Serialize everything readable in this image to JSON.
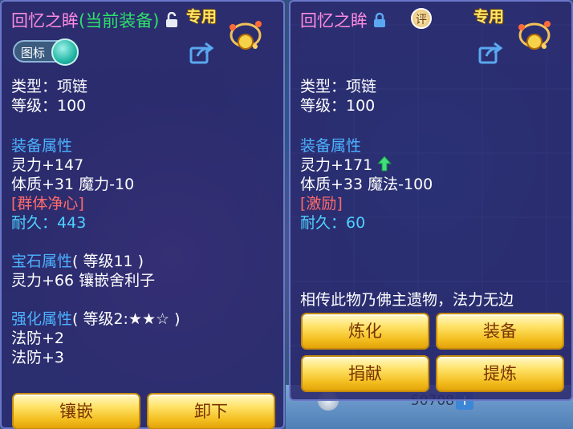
{
  "background": {
    "gold_amount": "50708",
    "gold_plus": "+"
  },
  "left": {
    "name": "回忆之眸",
    "equipped_tag": "(当前装备)",
    "exclusive": "专用",
    "toggle_label": "图标",
    "type_line": "类型：项链",
    "level_line": "等级：100",
    "equip_attr_header": "装备属性",
    "stat1": "灵力+147",
    "stat2": "体质+31 魔力-10",
    "special_skill": "[群体净心]",
    "durability_label": "耐久：",
    "durability_value": "443",
    "gem_header": "宝石属性",
    "gem_level": "( 等级11 )",
    "gem_line": "灵力+66 镶嵌舍利子",
    "enhance_header": "强化属性",
    "enhance_level": "( 等级2:★★☆ )",
    "enhance1": "法防+2",
    "enhance2": "法防+3",
    "btn_inlay": "镶嵌",
    "btn_unequip": "卸下"
  },
  "right": {
    "name": "回忆之眸",
    "ping_label": "评",
    "exclusive": "专用",
    "type_line": "类型：项链",
    "level_line": "等级：100",
    "equip_attr_header": "装备属性",
    "stat1": "灵力+171",
    "stat2": "体质+33 魔法-100",
    "special_skill": "[激励]",
    "durability_label": "耐久：",
    "durability_value": "60",
    "description": "相传此物乃佛主遗物，法力无边",
    "btn_refine": "炼化",
    "btn_equip": "装备",
    "btn_donate": "捐献",
    "btn_extract": "提炼"
  },
  "colors": {
    "title_pink": "#ff8ae0",
    "equipped_green": "#2ee06b",
    "section_blue": "#4db2ff",
    "skill_red": "#ff6a6a",
    "durability_cyan": "#4fd1ff",
    "button_gold": "#f3be1f"
  },
  "icons": [
    "lock-open-icon",
    "lock-closed-icon",
    "ornament-icon",
    "share-icon",
    "up-arrow-icon",
    "toggle-switch"
  ]
}
